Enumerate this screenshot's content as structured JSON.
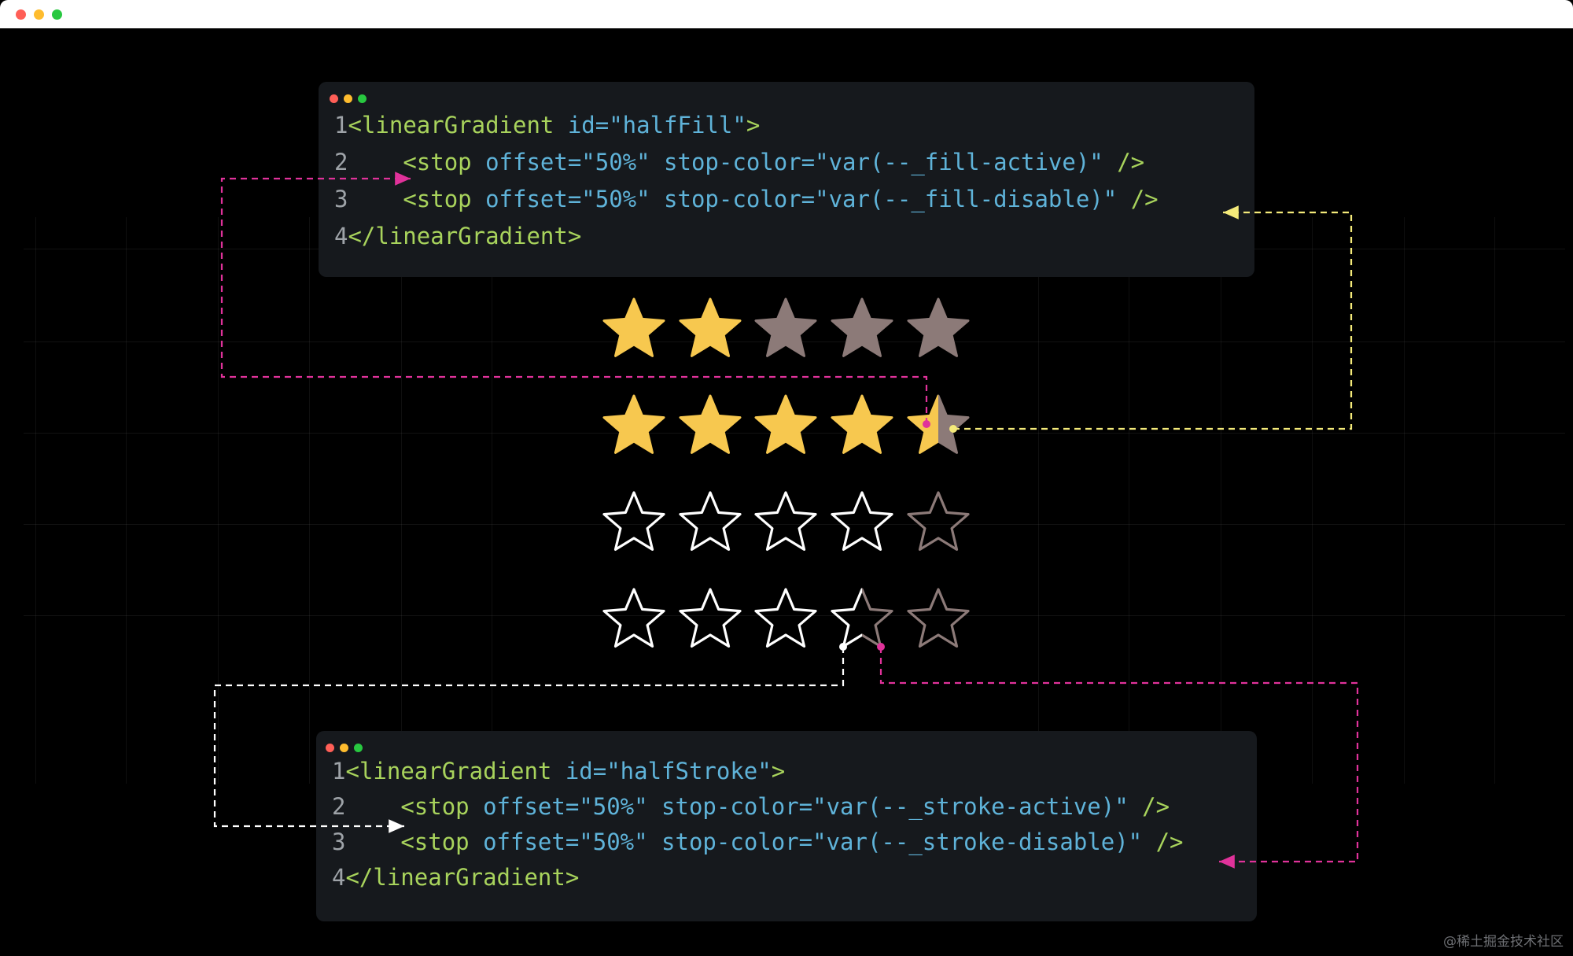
{
  "window": {
    "traffic_lights": {
      "close": "#ff5f57",
      "minimize": "#febc2e",
      "zoom": "#28c840"
    }
  },
  "top_code": {
    "lines": [
      {
        "num": "1",
        "indent": "",
        "open": "<",
        "tag": "linearGradient",
        "body": " id=\"halfFill\"",
        "close": ">"
      },
      {
        "num": "2",
        "indent": "    ",
        "open": "<",
        "tag": "stop",
        "body": " offset=\"50%\" stop-color=\"var(--_fill-active)\"",
        "close": " />"
      },
      {
        "num": "3",
        "indent": "    ",
        "open": "<",
        "tag": "stop",
        "body": " offset=\"50%\" stop-color=\"var(--_fill-disable)\"",
        "close": " />"
      },
      {
        "num": "4",
        "indent": "",
        "open": "</",
        "tag": "linearGradient",
        "body": "",
        "close": ">"
      }
    ]
  },
  "bottom_code": {
    "lines": [
      {
        "num": "1",
        "indent": "",
        "open": "<",
        "tag": "linearGradient",
        "body": " id=\"halfStroke\"",
        "close": ">"
      },
      {
        "num": "2",
        "indent": "    ",
        "open": "<",
        "tag": "stop",
        "body": " offset=\"50%\" stop-color=\"var(--_stroke-active)\"",
        "close": " />"
      },
      {
        "num": "3",
        "indent": "    ",
        "open": "<",
        "tag": "stop",
        "body": " offset=\"50%\" stop-color=\"var(--_stroke-disable)\"",
        "close": " />"
      },
      {
        "num": "4",
        "indent": "",
        "open": "</",
        "tag": "linearGradient",
        "body": "",
        "close": ">"
      }
    ]
  },
  "ratings": [
    {
      "style": "fill",
      "value": 2,
      "max": 5
    },
    {
      "style": "fill",
      "value": 4.5,
      "max": 5
    },
    {
      "style": "stroke",
      "value": 4,
      "max": 5
    },
    {
      "style": "stroke",
      "value": 3.5,
      "max": 5
    }
  ],
  "colors": {
    "fill_active": "#f7c84f",
    "fill_disable": "#8c7a78",
    "stroke_active": "#ffffff",
    "stroke_disable": "#8c7a78",
    "connector_pink": "#e0329a",
    "connector_yellow": "#f4ea7a",
    "connector_white": "#ffffff"
  },
  "watermark": "@稀土掘金技术社区"
}
